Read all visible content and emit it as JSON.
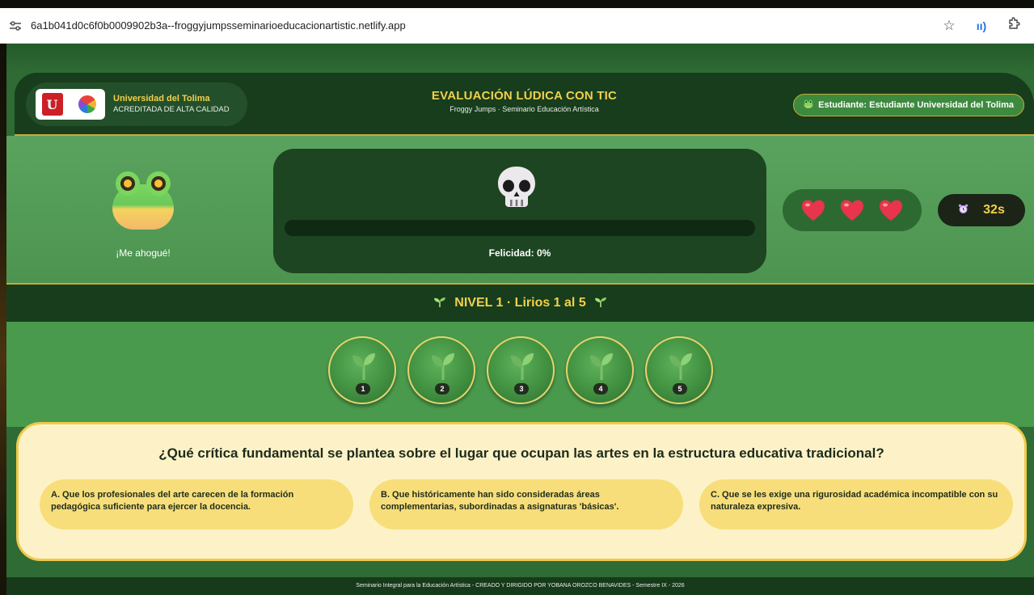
{
  "browser": {
    "url": "6a1b041d0c6f0b0009902b3a--froggyjumpsseminarioeducacionartistic.netlify.app",
    "site_info_icon": "tune-icon",
    "actions": [
      "star-icon",
      "read-aloud-icon",
      "extensions-icon"
    ]
  },
  "header": {
    "university_name": "Universidad del Tolima",
    "university_sub": "ACREDITADA DE ALTA CALIDAD",
    "logo_letter": "U",
    "title": "EVALUACIÓN LÚDICA CON TIC",
    "subtitle": "Froggy Jumps · Seminario Educación Artística",
    "student_label": "Estudiante: Estudiante Universidad del Tolima"
  },
  "status": {
    "frog_message": "¡Me ahogué!",
    "happiness_label": "Felicidad: 0%",
    "happiness_percent": 0,
    "lives": 3,
    "timer": "32s",
    "colors": {
      "heart": "#e8344c",
      "accent": "#f2d04b",
      "panel": "#1d4521"
    }
  },
  "level": {
    "title": "NIVEL 1 · Lirios 1 al 5"
  },
  "lilies": [
    {
      "number": "1"
    },
    {
      "number": "2"
    },
    {
      "number": "3"
    },
    {
      "number": "4"
    },
    {
      "number": "5"
    }
  ],
  "question": {
    "text": "¿Qué crítica fundamental se plantea sobre el lugar que ocupan las artes en la estructura educativa tradicional?",
    "options": [
      {
        "label": "A. Que los profesionales del arte carecen de la formación pedagógica suficiente para ejercer la docencia."
      },
      {
        "label": "B. Que históricamente han sido consideradas áreas complementarias, subordinadas a asignaturas 'básicas'."
      },
      {
        "label": "C. Que se les exige una rigurosidad académica incompatible con su naturaleza expresiva."
      }
    ]
  },
  "footer": {
    "text": "Seminario Integral para la Educación Artística - CREADO Y DIRIGIDO POR YOBANA OROZCO BENAVIDES - Semestre IX - 2026"
  }
}
